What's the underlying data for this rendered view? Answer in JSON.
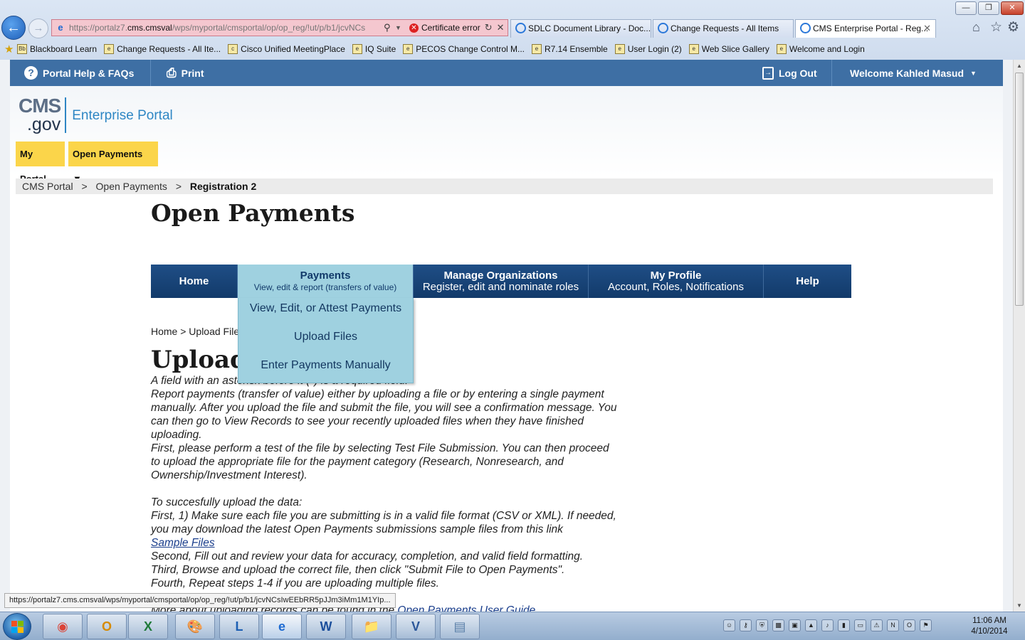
{
  "browser": {
    "address_url_prefix": "https://portalz7.",
    "address_url_domain": "cms.cmsval",
    "address_url_suffix": "/wps/myportal/cmsportal/op/op_reg/!ut/p/b1/jcvNCs",
    "cert_error": "Certificate error",
    "tabs": [
      {
        "label": "SDLC Document Library - Doc..."
      },
      {
        "label": "Change Requests - All Items"
      },
      {
        "label": "CMS Enterprise Portal - Reg..."
      }
    ],
    "favorites": [
      {
        "label": "Blackboard Learn",
        "icon": "Bb"
      },
      {
        "label": "Change Requests - All Ite...",
        "icon": "e"
      },
      {
        "label": "Cisco Unified MeetingPlace",
        "icon": "cisco"
      },
      {
        "label": "IQ Suite",
        "icon": "e"
      },
      {
        "label": "PECOS Change Control M...",
        "icon": "e"
      },
      {
        "label": "R7.14 Ensemble",
        "icon": "e"
      },
      {
        "label": "User Login (2)",
        "icon": "e"
      },
      {
        "label": "Web Slice Gallery",
        "icon": "e"
      },
      {
        "label": "Welcome and Login",
        "icon": "e"
      }
    ],
    "status_url": "https://portalz7.cms.cmsval/wps/myportal/cmsportal/op/op_reg/!ut/p/b1/jcvNCsIwEEbRR5pJJm3iMm1M1YIp..."
  },
  "portal": {
    "help_label": "Portal Help & FAQs",
    "print_label": "Print",
    "logout_label": "Log Out",
    "welcome_label": "Welcome Kahled Masud",
    "logo_cms": "CMS",
    "logo_gov": ".gov",
    "logo_text": "Enterprise Portal",
    "my_portal_label": "My Portal",
    "open_payments_menu_label": "Open Payments ▼",
    "breadcrumb": [
      "CMS Portal",
      "Open Payments",
      "Registration 2"
    ],
    "breadcrumb_sep": ">",
    "page_title": "Open Payments"
  },
  "nav": {
    "home": "Home",
    "payments_title": "Payments",
    "payments_sub": "View, edit & report (transfers of value)",
    "manage_title": "Manage Organizations",
    "manage_sub": "Register, edit and nominate roles",
    "profile_title": "My Profile",
    "profile_sub": "Account, Roles, Notifications",
    "help": "Help"
  },
  "dropdown": {
    "items": [
      "View, Edit, or Attest Payments",
      "Upload Files",
      "Enter Payments Manually"
    ]
  },
  "content": {
    "breadcrumb": "Home > Upload Files",
    "heading": "Upload Files",
    "required_note_start": "A field with an asterisk before it (",
    "required_star": "*",
    "required_note_end": ") is a required field.",
    "paragraph1": "Report payments (transfer of value) either by uploading a file or by entering a single payment manually. After you upload the file and submit the file, you will see a confirmation message. You can then go to View Records to see your recently uploaded files when they have finished uploading.",
    "paragraph2": "First, please perform a test of the file by selecting Test File Submission. You can then proceed to upload the appropriate file for the payment category (Research, Nonresearch, and Ownership/Investment Interest).",
    "steps_intro": "To succesfully upload the data:",
    "step1": "First, 1) Make sure each file you are submitting is in a valid file format (CSV or XML). If needed, you may download the latest Open Payments submissions sample files from this link",
    "sample_files_link": "Sample Files",
    "step2": "Second, Fill out and review your data for accuracy, completion, and valid field formatting.",
    "step3": "Third, Browse and upload the correct file, then click \"Submit File to Open Payments\".",
    "step4": "Fourth, Repeat steps 1-4 if you are uploading multiple files.",
    "more_info_start": "More about uploading records can be found in the ",
    "user_guide_link": "Open Payments User Guide"
  },
  "taskbar": {
    "time": "11:06 AM",
    "date": "4/10/2014",
    "apps": [
      "chrome",
      "outlook",
      "excel",
      "paint",
      "lync",
      "internet-explorer",
      "word",
      "file-explorer",
      "visio",
      "notepad"
    ]
  },
  "colors": {
    "portal_blue": "#3e6fa4",
    "nav_dark_blue": "#1f4e86",
    "dropdown_bg": "#9fd1e0",
    "yellow_button": "#fbd54a"
  }
}
